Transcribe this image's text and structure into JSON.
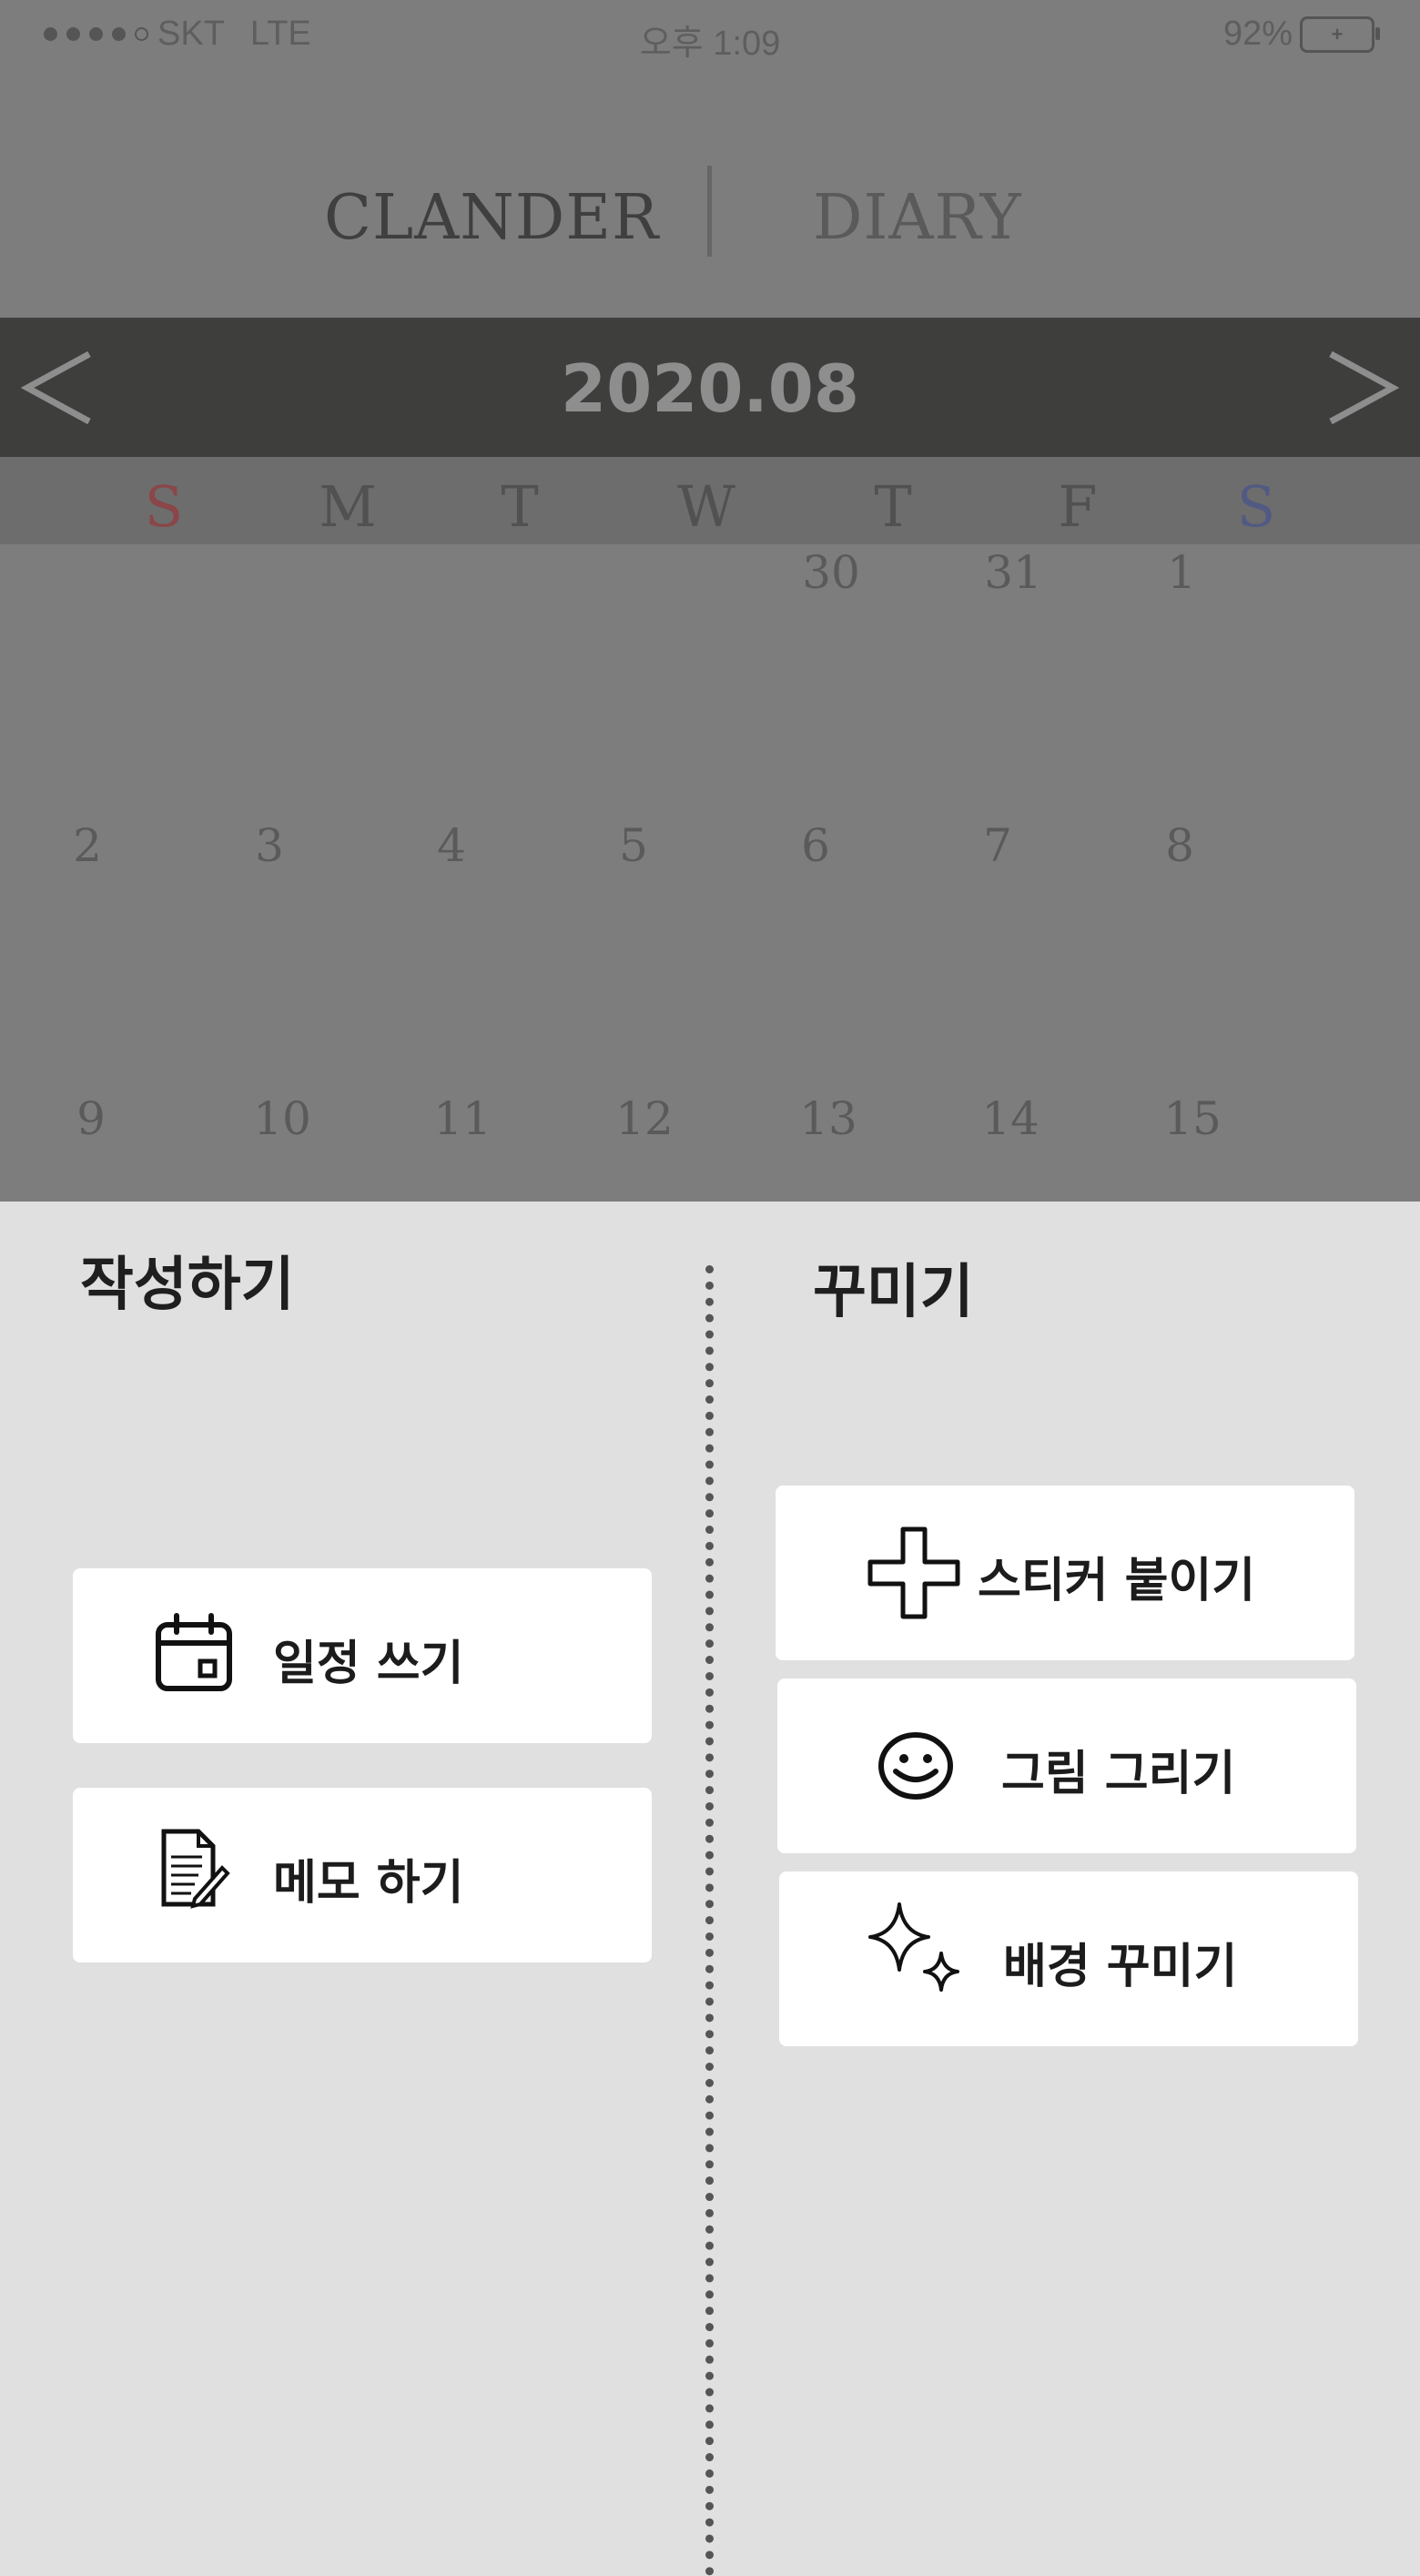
{
  "status_bar": {
    "carrier": "SKT",
    "network": "LTE",
    "time": "오후 1:09",
    "battery_percent": "92%"
  },
  "tabs": [
    {
      "label": "CLANDER"
    },
    {
      "label": "DIARY"
    }
  ],
  "calendar": {
    "month": "2020.08",
    "weekdays": [
      "S",
      "M",
      "T",
      "W",
      "T",
      "F",
      "S"
    ],
    "week1": [
      "30",
      "31",
      "1"
    ],
    "week2": [
      "2",
      "3",
      "4",
      "5",
      "6",
      "7",
      "8"
    ],
    "week3": [
      "9",
      "10",
      "11",
      "12",
      "13",
      "14",
      "15"
    ]
  },
  "write_section": {
    "title": "작성하기",
    "items": [
      {
        "label": "일정 쓰기",
        "icon": "calendar-icon"
      },
      {
        "label": "메모 하기",
        "icon": "memo-icon"
      }
    ]
  },
  "decorate_section": {
    "title": "꾸미기",
    "items": [
      {
        "label": "스티커 붙이기",
        "icon": "plus-icon"
      },
      {
        "label": "그림 그리기",
        "icon": "smiley-icon"
      },
      {
        "label": "배경 꾸미기",
        "icon": "sparkle-icon"
      }
    ]
  }
}
